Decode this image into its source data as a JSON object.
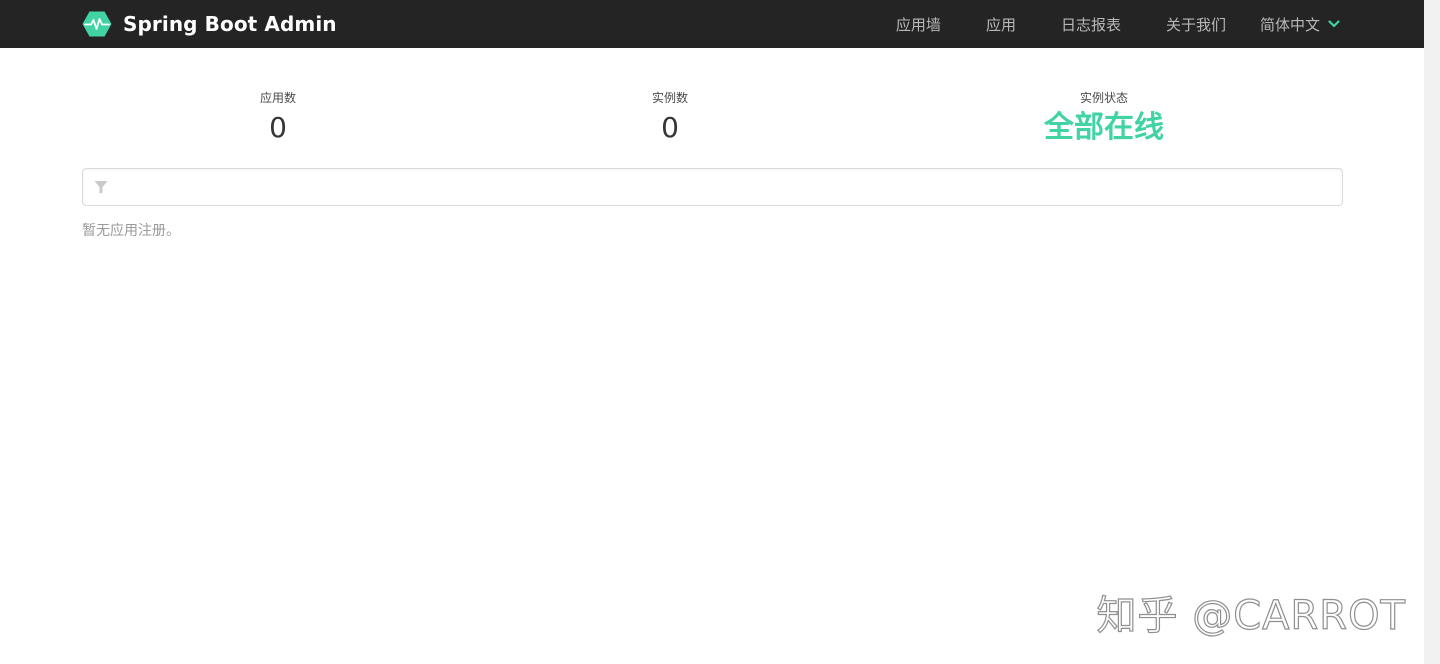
{
  "app": {
    "title": "Spring Boot Admin",
    "logo_icon": "heartbeat-hexagon-icon",
    "accent_color": "#42d3a5"
  },
  "nav": {
    "items": [
      {
        "label": "应用墙"
      },
      {
        "label": "应用"
      },
      {
        "label": "日志报表"
      },
      {
        "label": "关于我们"
      }
    ],
    "language": {
      "label": "简体中文",
      "icon": "chevron-down-icon"
    }
  },
  "stats": {
    "applications": {
      "label": "应用数",
      "value": "0"
    },
    "instances": {
      "label": "实例数",
      "value": "0"
    },
    "status": {
      "label": "实例状态",
      "value": "全部在线"
    }
  },
  "filter": {
    "icon": "filter-icon",
    "value": "",
    "placeholder": ""
  },
  "empty_message": "暂无应用注册。",
  "watermark": "知乎 @CARROT"
}
